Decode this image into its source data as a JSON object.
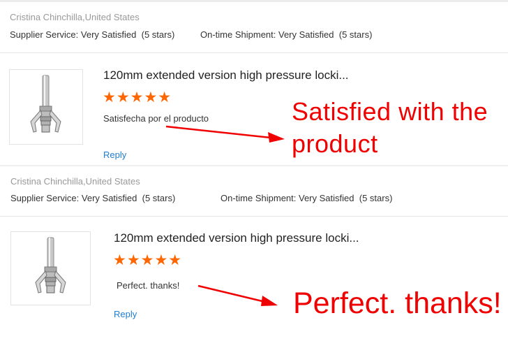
{
  "reviews": [
    {
      "reviewer": "Cristina Chinchilla,United States",
      "supplier_service_label": "Supplier Service:",
      "supplier_service_value": "Very Satisfied",
      "supplier_service_stars": "(5 stars)",
      "shipment_label": "On-time Shipment:",
      "shipment_value": "Very Satisfied",
      "shipment_stars": "(5 stars)",
      "product_title": "120mm extended version high pressure locki...",
      "rating": 5,
      "stars_glyphs": "★★★★★",
      "comment": "Satisfecha por el producto",
      "reply_label": "Reply",
      "annotation": "Satisfied with the product",
      "annotation_line1": "Satisfied with the",
      "annotation_line2": "product"
    },
    {
      "reviewer": "Cristina Chinchilla,United States",
      "supplier_service_label": "Supplier Service:",
      "supplier_service_value": "Very Satisfied",
      "supplier_service_stars": "(5 stars)",
      "shipment_label": "On-time Shipment:",
      "shipment_value": "Very Satisfied",
      "shipment_stars": "(5 stars)",
      "product_title": "120mm extended version high pressure locki...",
      "rating": 5,
      "stars_glyphs": "★★★★★",
      "comment": "Perfect. thanks!",
      "reply_label": "Reply",
      "annotation": "Perfect. thanks!"
    }
  ],
  "colors": {
    "star": "#ff6600",
    "link": "#1f7ed0",
    "annotation": "#f00000",
    "muted_text": "#999999"
  },
  "icons": {
    "product_thumbnail": "grease-coupler-tool-icon",
    "annotation_arrow": "red-arrow-icon"
  }
}
